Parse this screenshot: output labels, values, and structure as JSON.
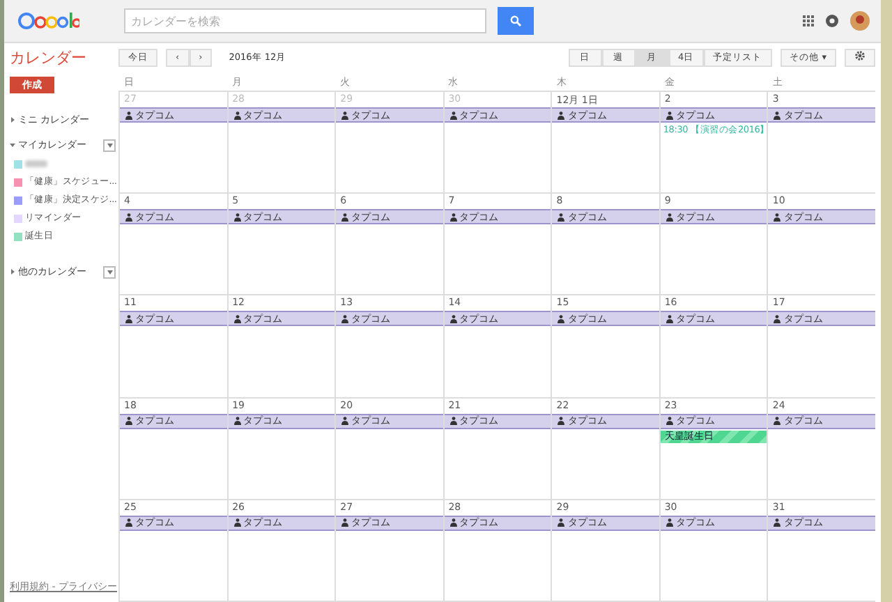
{
  "header": {
    "search": {
      "placeholder": "カレンダーを検索"
    }
  },
  "app_title": "カレンダー",
  "toolbar": {
    "today": "今日",
    "prev": "‹",
    "next": "›",
    "period": "2016年 12月",
    "views": [
      {
        "label": "日",
        "selected": false
      },
      {
        "label": "週",
        "selected": false
      },
      {
        "label": "月",
        "selected": true
      },
      {
        "label": "4日",
        "selected": false
      },
      {
        "label": "予定リスト",
        "selected": false
      }
    ],
    "more": "その他",
    "more_caret": "▾"
  },
  "sidebar": {
    "create": "作成",
    "sections": [
      {
        "label": "ミニ カレンダー",
        "expanded": false,
        "menu": false
      },
      {
        "label": "マイカレンダー",
        "expanded": true,
        "menu": true,
        "items": [
          {
            "blurred": true,
            "color": "#9fe1e7"
          },
          {
            "label": "「健康」スケジュー...",
            "blurred": false,
            "color": "#f691b2"
          },
          {
            "label": "「健康」決定スケジ...",
            "blurred": false,
            "color": "#9a9cff"
          },
          {
            "label": "リマインダー",
            "blurred": false,
            "color": "#e3d7ff"
          },
          {
            "label": "誕生日",
            "blurred": false,
            "color": "#92e1c0"
          }
        ]
      },
      {
        "label": "他のカレンダー",
        "expanded": false,
        "menu": true
      }
    ],
    "footer": "利用規約 - プライバシー"
  },
  "weekdays": [
    "日",
    "月",
    "火",
    "水",
    "木",
    "金",
    "土"
  ],
  "weeks": [
    {
      "days": [
        {
          "label": "27",
          "other_month": true,
          "events": [
            {
              "kind": "bar",
              "text": "タプコム"
            }
          ]
        },
        {
          "label": "28",
          "other_month": true,
          "events": [
            {
              "kind": "bar",
              "text": "タプコム"
            }
          ]
        },
        {
          "label": "29",
          "other_month": true,
          "events": [
            {
              "kind": "bar",
              "text": "タプコム"
            }
          ]
        },
        {
          "label": "30",
          "other_month": true,
          "events": [
            {
              "kind": "bar",
              "text": "タプコム"
            }
          ]
        },
        {
          "label": "12月 1日",
          "other_month": false,
          "events": [
            {
              "kind": "bar",
              "text": "タプコム"
            }
          ]
        },
        {
          "label": "2",
          "other_month": false,
          "events": [
            {
              "kind": "bar",
              "text": "タプコム"
            },
            {
              "kind": "timed",
              "time": "18:30",
              "text": "【演習の会2016】"
            }
          ]
        },
        {
          "label": "3",
          "other_month": false,
          "events": [
            {
              "kind": "bar",
              "text": "タプコム"
            }
          ]
        }
      ]
    },
    {
      "days": [
        {
          "label": "4",
          "other_month": false,
          "events": [
            {
              "kind": "bar",
              "text": "タプコム"
            }
          ]
        },
        {
          "label": "5",
          "other_month": false,
          "events": [
            {
              "kind": "bar",
              "text": "タプコム"
            }
          ]
        },
        {
          "label": "6",
          "other_month": false,
          "events": [
            {
              "kind": "bar",
              "text": "タプコム"
            }
          ]
        },
        {
          "label": "7",
          "other_month": false,
          "events": [
            {
              "kind": "bar",
              "text": "タプコム"
            }
          ]
        },
        {
          "label": "8",
          "other_month": false,
          "events": [
            {
              "kind": "bar",
              "text": "タプコム"
            }
          ]
        },
        {
          "label": "9",
          "other_month": false,
          "events": [
            {
              "kind": "bar",
              "text": "タプコム"
            }
          ]
        },
        {
          "label": "10",
          "other_month": false,
          "events": [
            {
              "kind": "bar",
              "text": "タプコム"
            }
          ]
        }
      ]
    },
    {
      "days": [
        {
          "label": "11",
          "other_month": false,
          "events": [
            {
              "kind": "bar",
              "text": "タプコム"
            }
          ]
        },
        {
          "label": "12",
          "other_month": false,
          "events": [
            {
              "kind": "bar",
              "text": "タプコム"
            }
          ]
        },
        {
          "label": "13",
          "other_month": false,
          "events": [
            {
              "kind": "bar",
              "text": "タプコム"
            }
          ]
        },
        {
          "label": "14",
          "other_month": false,
          "events": [
            {
              "kind": "bar",
              "text": "タプコム"
            }
          ]
        },
        {
          "label": "15",
          "other_month": false,
          "events": [
            {
              "kind": "bar",
              "text": "タプコム"
            }
          ]
        },
        {
          "label": "16",
          "other_month": false,
          "events": [
            {
              "kind": "bar",
              "text": "タプコム"
            }
          ]
        },
        {
          "label": "17",
          "other_month": false,
          "events": [
            {
              "kind": "bar",
              "text": "タプコム"
            }
          ]
        }
      ]
    },
    {
      "days": [
        {
          "label": "18",
          "other_month": false,
          "events": [
            {
              "kind": "bar",
              "text": "タプコム"
            }
          ]
        },
        {
          "label": "19",
          "other_month": false,
          "events": [
            {
              "kind": "bar",
              "text": "タプコム"
            }
          ]
        },
        {
          "label": "20",
          "other_month": false,
          "events": [
            {
              "kind": "bar",
              "text": "タプコム"
            }
          ]
        },
        {
          "label": "21",
          "other_month": false,
          "events": [
            {
              "kind": "bar",
              "text": "タプコム"
            }
          ]
        },
        {
          "label": "22",
          "other_month": false,
          "events": [
            {
              "kind": "bar",
              "text": "タプコム"
            }
          ]
        },
        {
          "label": "23",
          "other_month": false,
          "events": [
            {
              "kind": "bar",
              "text": "タプコム"
            },
            {
              "kind": "holiday",
              "text": "天皇誕生日"
            }
          ]
        },
        {
          "label": "24",
          "other_month": false,
          "events": [
            {
              "kind": "bar",
              "text": "タプコム"
            }
          ]
        }
      ]
    },
    {
      "days": [
        {
          "label": "25",
          "other_month": false,
          "events": [
            {
              "kind": "bar",
              "text": "タプコム"
            }
          ]
        },
        {
          "label": "26",
          "other_month": false,
          "events": [
            {
              "kind": "bar",
              "text": "タプコム"
            }
          ]
        },
        {
          "label": "27",
          "other_month": false,
          "events": [
            {
              "kind": "bar",
              "text": "タプコム"
            }
          ]
        },
        {
          "label": "28",
          "other_month": false,
          "events": [
            {
              "kind": "bar",
              "text": "タプコム"
            }
          ]
        },
        {
          "label": "29",
          "other_month": false,
          "events": [
            {
              "kind": "bar",
              "text": "タプコム"
            }
          ]
        },
        {
          "label": "30",
          "other_month": false,
          "events": [
            {
              "kind": "bar",
              "text": "タプコム"
            }
          ]
        },
        {
          "label": "31",
          "other_month": false,
          "events": [
            {
              "kind": "bar",
              "text": "タプコム"
            }
          ]
        }
      ]
    }
  ]
}
